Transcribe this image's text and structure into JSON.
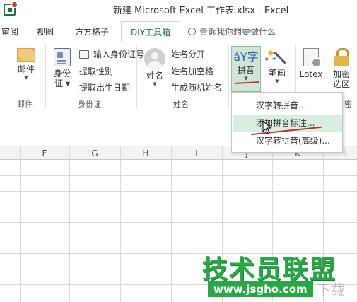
{
  "window": {
    "title": "新建 Microsoft Excel 工作表.xlsx - Excel"
  },
  "tabs": {
    "review": "审阅",
    "view": "视图",
    "ffgz": "方方格子",
    "diy": "DIY工具箱",
    "tell_me": "告诉我你想要做什么"
  },
  "ribbon": {
    "mail_group": {
      "button": "邮件",
      "label": "邮件"
    },
    "id_group": {
      "button_line1": "身份",
      "button_line2": "证",
      "items": [
        "输入身份证号",
        "提取性别",
        "提取出生日期"
      ],
      "label": "身份证"
    },
    "name_group": {
      "button": "姓名",
      "items": [
        "姓名分开",
        "姓名加空格",
        "生成随机姓名"
      ],
      "label": "姓名"
    },
    "pinyin_group": {
      "glyph": "áY字",
      "button": "拼音"
    },
    "brush_group": {
      "button": "笔画"
    },
    "lotex_group": {
      "button": "Lotex"
    },
    "encrypt_group": {
      "button_line1": "加密",
      "button_line2": "选区"
    },
    "partial_label": "密"
  },
  "pinyin_menu": {
    "items": [
      "汉字转拼音...",
      "添加拼音标注...",
      "汉字转拼音(高级)..."
    ],
    "highlighted": 1
  },
  "grid": {
    "columns": [
      "F",
      "G",
      "H",
      "I",
      "J",
      "K",
      "L"
    ]
  },
  "watermark": {
    "text": "技术员联盟",
    "url": "www.jsgho.com",
    "corner": "下载"
  },
  "colors": {
    "accent": "#217346",
    "menu_highlight": "#d8efe0",
    "annotation": "#c0302c",
    "watermark": "#27a844"
  }
}
